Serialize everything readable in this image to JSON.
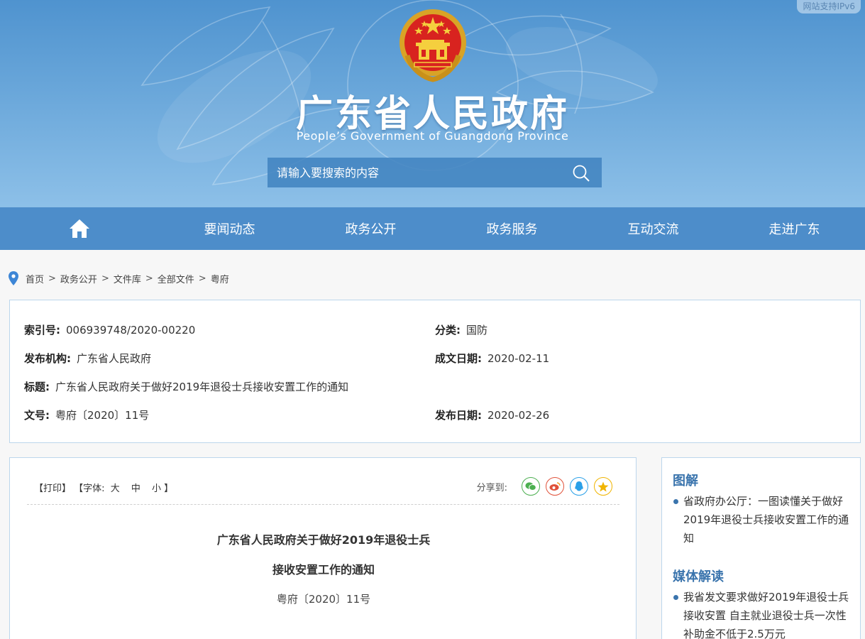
{
  "header": {
    "ipv6_badge": "网站支持IPv6",
    "title": "广东省人民政府",
    "subtitle": "People’s Government of Guangdong Province"
  },
  "search": {
    "placeholder": "请输入要搜索的内容"
  },
  "nav": {
    "items": [
      {
        "label": "要闻动态"
      },
      {
        "label": "政务公开"
      },
      {
        "label": "政务服务"
      },
      {
        "label": "互动交流"
      },
      {
        "label": "走进广东"
      }
    ]
  },
  "breadcrumb": {
    "items": [
      "首页",
      "政务公开",
      "文件库",
      "全部文件",
      "粤府"
    ],
    "separator": ">"
  },
  "meta": {
    "index_no": {
      "label": "索引号:",
      "value": "006939748/2020-00220"
    },
    "category": {
      "label": "分类:",
      "value": "国防"
    },
    "publisher": {
      "label": "发布机构:",
      "value": "广东省人民政府"
    },
    "written_date": {
      "label": "成文日期:",
      "value": "2020-02-11"
    },
    "title": {
      "label": "标题:",
      "value": "广东省人民政府关于做好2019年退役士兵接收安置工作的通知"
    },
    "doc_no": {
      "label": "文号:",
      "value": "粤府〔2020〕11号"
    },
    "publish_date": {
      "label": "发布日期:",
      "value": "2020-02-26"
    }
  },
  "article": {
    "toolbar": {
      "print": "【打印】",
      "font_prefix": "【字体:",
      "font_large": "大",
      "font_medium": "中",
      "font_small": "小",
      "font_suffix": "】",
      "share_label": "分享到:"
    },
    "title_line1": "广东省人民政府关于做好2019年退役士兵",
    "title_line2": "接收安置工作的通知",
    "doc_number": "粤府〔2020〕11号"
  },
  "sidebar": {
    "sections": [
      {
        "heading": "图解",
        "item": "省政府办公厅：一图读懂关于做好2019年退役士兵接收安置工作的通知"
      },
      {
        "heading": "媒体解读",
        "item": "我省发文要求做好2019年退役士兵接收安置 自主就业退役士兵一次性补助金不低于2.5万元"
      }
    ]
  },
  "colors": {
    "nav_bg": "#4d8dca",
    "accent": "#3a74ad",
    "panel_border": "#bcd6ec",
    "wechat": "#4caf50",
    "weibo": "#e0523a",
    "qq": "#2aa0e8",
    "qzone": "#f0b400"
  }
}
